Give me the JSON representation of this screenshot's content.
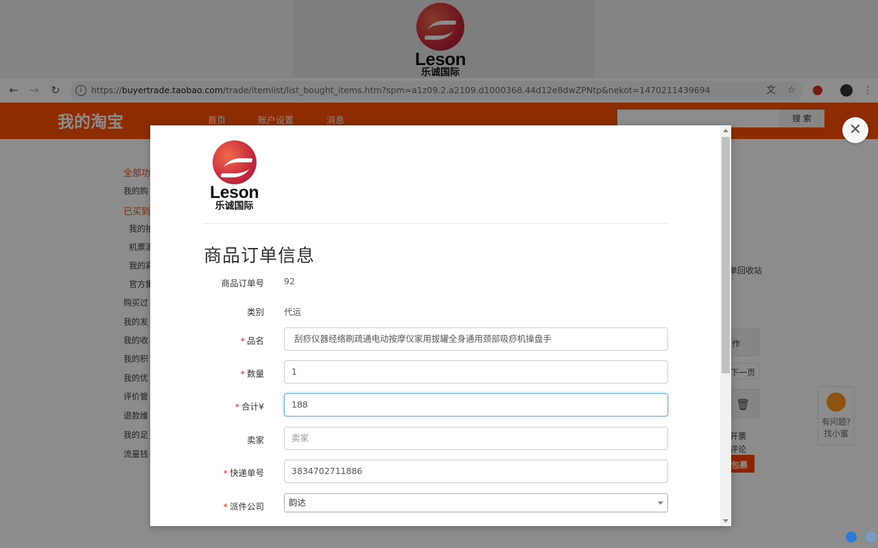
{
  "top_logo": {
    "wordmark": "Leson",
    "cn": "乐诚国际"
  },
  "browser": {
    "url_prefix": "https://",
    "url_host": "buyertrade.taobao.com",
    "url_path": "/trade/itemlist/list_bought_items.htm?spm=a1z09.2.a2109.d1000368.44d12e8dwZPNtp&nekot=1470211439694",
    "back_icon": "←",
    "forward_icon": "→",
    "reload_icon": "↻",
    "info_icon": "i",
    "translate_icon": "文",
    "star_icon": "☆",
    "menu_icon": "⋮"
  },
  "taobao": {
    "brand": "我的淘宝",
    "nav": [
      "首页",
      "账户设置",
      "消息"
    ],
    "search_button": "搜 索",
    "sidebar": [
      {
        "text": "全部功",
        "red": true
      },
      {
        "text": "我的购",
        "red": false
      },
      {
        "text": "已买到",
        "red": true
      },
      {
        "text": "我的拍",
        "red": false
      },
      {
        "text": "机票酒",
        "red": false
      },
      {
        "text": "我的彩",
        "red": false
      },
      {
        "text": "官方集",
        "red": false
      },
      {
        "text": "购买过",
        "red": false
      },
      {
        "text": "我的发",
        "red": false
      },
      {
        "text": "我的收",
        "red": false
      },
      {
        "text": "我的积",
        "red": false
      },
      {
        "text": "我的优",
        "red": false
      },
      {
        "text": "评价管",
        "red": false
      },
      {
        "text": "退款维",
        "red": false
      },
      {
        "text": "我的足",
        "red": false
      },
      {
        "text": "流量钱",
        "red": false
      }
    ],
    "right_snippets": {
      "recycle": "单回收站",
      "ops": "作",
      "next_page": "下一页",
      "ticket": "开票",
      "review": "评论",
      "package": "包裹"
    },
    "help_widget": {
      "line1": "有问题?",
      "line2": "找小蜜"
    }
  },
  "modal": {
    "close_icon": "✕",
    "logo": {
      "wordmark": "Leson",
      "cn": "乐诚国际"
    },
    "title": "商品订单信息",
    "fields": {
      "order_no": {
        "label": "商品订单号",
        "value": "92"
      },
      "category": {
        "label": "类别",
        "value": "代运"
      },
      "name": {
        "label": "品名",
        "value": "刮痧仪器经络刷疏通电动按摩仪家用拔罐全身通用颈部吸痧机操盘手"
      },
      "quantity": {
        "label": "数量",
        "value": "1"
      },
      "total": {
        "label": "合计¥",
        "value": "188"
      },
      "seller": {
        "label": "卖家",
        "placeholder": "卖家"
      },
      "tracking": {
        "label": "快递单号",
        "value": "3834702711886"
      },
      "courier": {
        "label": "派件公司",
        "value": "韵达"
      }
    },
    "required_mark": "*"
  }
}
